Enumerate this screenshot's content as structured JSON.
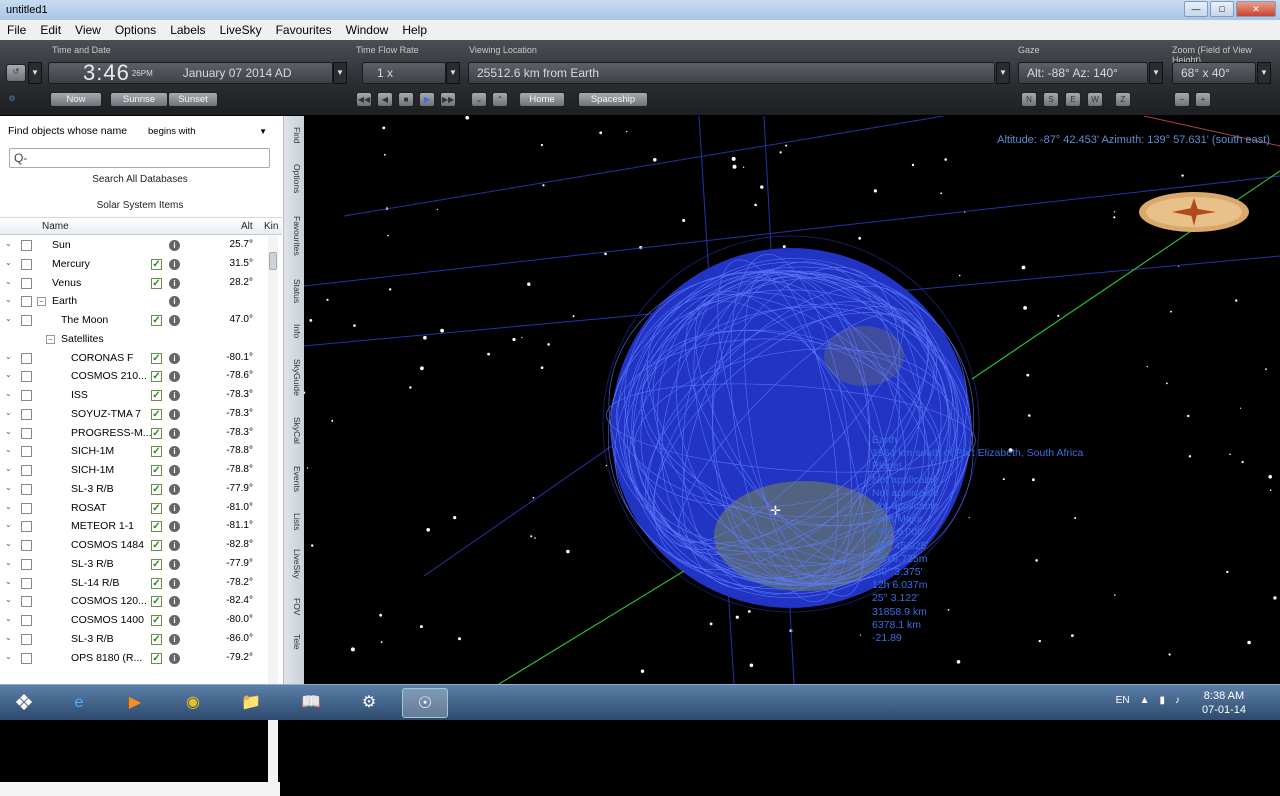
{
  "window": {
    "title": "untitled1"
  },
  "menu": [
    "File",
    "Edit",
    "View",
    "Options",
    "Labels",
    "LiveSky",
    "Favourites",
    "Window",
    "Help"
  ],
  "toolbar": {
    "time_label": "Time and Date",
    "time": "3:46",
    "ampm": "26PM",
    "date": "January 07   2014 AD",
    "flow_label": "Time Flow Rate",
    "flow": "1 x",
    "viewing_label": "Viewing Location",
    "viewing": "25512.6 km from Earth",
    "gaze_label": "Gaze",
    "gaze": "Alt: -88° Az: 140°",
    "zoom_label": "Zoom (Field of View Height)",
    "zoom": "68° x 40°",
    "now": "Now",
    "sunrise": "Sunrise",
    "sunset": "Sunset",
    "home": "Home",
    "spaceship": "Spaceship",
    "dirs": [
      "N",
      "S",
      "E",
      "W",
      "Z"
    ]
  },
  "find": {
    "label": "Find objects whose name",
    "mode": "begins with",
    "search_placeholder": "Q-",
    "search_all": "Search All Databases",
    "solar_items": "Solar System Items"
  },
  "list": {
    "headers": {
      "name": "Name",
      "alt": "Alt",
      "kind": "Kin"
    },
    "rows": [
      {
        "name": "Sun",
        "alt": "25.7°",
        "checked": false,
        "level": 0
      },
      {
        "name": "Mercury",
        "alt": "31.5°",
        "checked": true,
        "level": 0
      },
      {
        "name": "Venus",
        "alt": "28.2°",
        "checked": true,
        "level": 0
      },
      {
        "name": "Earth",
        "alt": "",
        "checked": false,
        "level": 0,
        "expander": true
      },
      {
        "name": "The Moon",
        "alt": "47.0°",
        "checked": true,
        "level": 1
      },
      {
        "name": "Satellites",
        "alt": "",
        "checked": null,
        "level": 1,
        "expander": true,
        "group": true
      },
      {
        "name": "CORONAS F",
        "alt": "-80.1°",
        "checked": true,
        "level": 2
      },
      {
        "name": "COSMOS 210...",
        "alt": "-78.6°",
        "checked": true,
        "level": 2
      },
      {
        "name": "ISS",
        "alt": "-78.3°",
        "checked": true,
        "level": 2
      },
      {
        "name": "SOYUZ-TMA 7",
        "alt": "-78.3°",
        "checked": true,
        "level": 2
      },
      {
        "name": "PROGRESS-M...",
        "alt": "-78.3°",
        "checked": true,
        "level": 2
      },
      {
        "name": "SICH-1M",
        "alt": "-78.8°",
        "checked": true,
        "level": 2
      },
      {
        "name": "SICH-1M",
        "alt": "-78.8°",
        "checked": true,
        "level": 2
      },
      {
        "name": "SL-3 R/B",
        "alt": "-77.9°",
        "checked": true,
        "level": 2
      },
      {
        "name": "ROSAT",
        "alt": "-81.0°",
        "checked": true,
        "level": 2
      },
      {
        "name": "METEOR 1-1",
        "alt": "-81.1°",
        "checked": true,
        "level": 2
      },
      {
        "name": "COSMOS 1484",
        "alt": "-82.8°",
        "checked": true,
        "level": 2
      },
      {
        "name": "SL-3 R/B",
        "alt": "-77.9°",
        "checked": true,
        "level": 2
      },
      {
        "name": "SL-14 R/B",
        "alt": "-78.2°",
        "checked": true,
        "level": 2
      },
      {
        "name": "COSMOS 120...",
        "alt": "-82.4°",
        "checked": true,
        "level": 2
      },
      {
        "name": "COSMOS 1400",
        "alt": "-80.0°",
        "checked": true,
        "level": 2
      },
      {
        "name": "SL-3 R/B",
        "alt": "-86.0°",
        "checked": true,
        "level": 2
      },
      {
        "name": "OPS 8180 (R...",
        "alt": "-79.2°",
        "checked": true,
        "level": 2
      }
    ]
  },
  "side_tabs": [
    "Find",
    "Options",
    "Favourites",
    "Status",
    "Info",
    "SkyGuide",
    "SkyCal",
    "Events",
    "Lists",
    "LiveSky",
    "FOV",
    "Tele"
  ],
  "sky": {
    "altaz": "Altitude: -87° 42.453'  Azimuth: 139° 57.631' (south east)",
    "info_lines": [
      "Earth",
      "1964 km south of Port Elizabeth, South Africa",
      "Planet",
      "Not applicable",
      "Not applicable",
      "Not applicable",
      "Ursa Major",
      "180° 0.000'",
      "-89° 45.925'",
      "13h 6.725m",
      "-89° 3.375'",
      "12h 6.037m",
      "25° 3.122'",
      "31858.9 km",
      "6378.1 km",
      "-21.89"
    ]
  },
  "taskbar": {
    "lang": "EN",
    "time": "8:38 AM",
    "date": "07-01-14"
  }
}
